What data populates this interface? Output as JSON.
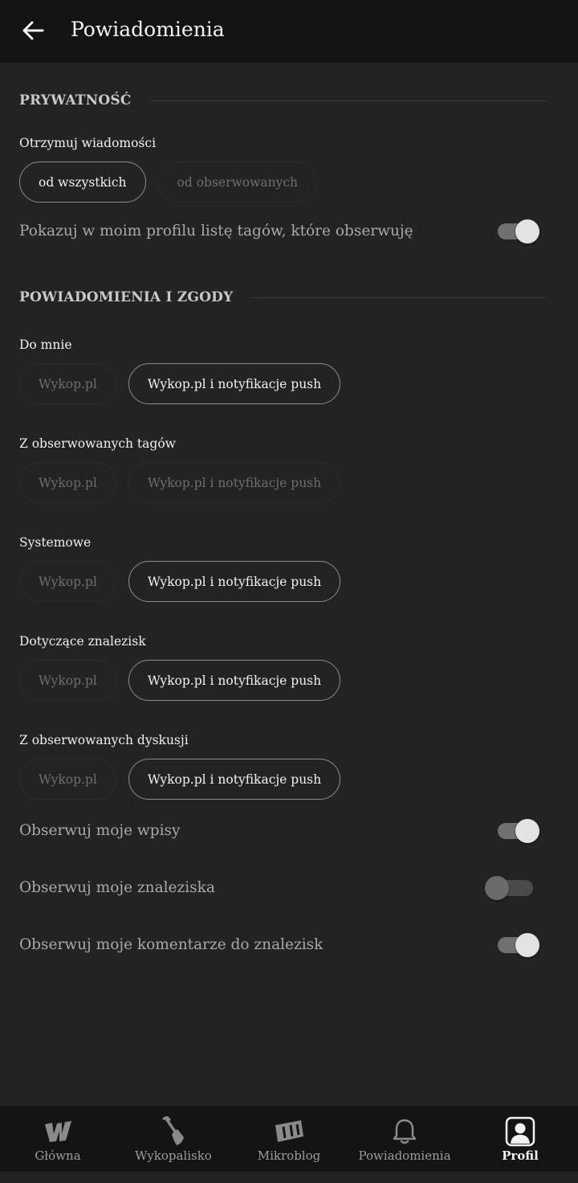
{
  "appbar": {
    "title": "Powiadomienia",
    "back_icon": "arrow-left-icon"
  },
  "privacy": {
    "section_title": "PRYWATNOŚĆ",
    "receive_label": "Otrzymuj wiadomości",
    "receive_options": [
      {
        "label": "od wszystkich",
        "selected": true
      },
      {
        "label": "od obserwowanych",
        "selected": false
      }
    ],
    "show_tags": {
      "label": "Pokazuj w moim profilu listę tagów, które obserwuję",
      "on": true
    }
  },
  "notifications": {
    "section_title": "POWIADOMIENIA I ZGODY",
    "groups": [
      {
        "label": "Do mnie",
        "options": [
          {
            "label": "Wykop.pl",
            "selected": false
          },
          {
            "label": "Wykop.pl i notyfikacje push",
            "selected": true
          }
        ]
      },
      {
        "label": "Z obserwowanych tagów",
        "options": [
          {
            "label": "Wykop.pl",
            "selected": false
          },
          {
            "label": "Wykop.pl i notyfikacje push",
            "selected": false
          }
        ]
      },
      {
        "label": "Systemowe",
        "options": [
          {
            "label": "Wykop.pl",
            "selected": false
          },
          {
            "label": "Wykop.pl i notyfikacje push",
            "selected": true
          }
        ]
      },
      {
        "label": "Dotyczące znalezisk",
        "options": [
          {
            "label": "Wykop.pl",
            "selected": false
          },
          {
            "label": "Wykop.pl i notyfikacje push",
            "selected": true
          }
        ]
      },
      {
        "label": "Z obserwowanych dyskusji",
        "options": [
          {
            "label": "Wykop.pl",
            "selected": false
          },
          {
            "label": "Wykop.pl i notyfikacje push",
            "selected": true
          }
        ]
      }
    ],
    "toggles": [
      {
        "label": "Obserwuj moje wpisy",
        "on": true
      },
      {
        "label": "Obserwuj moje znaleziska",
        "on": false
      },
      {
        "label": "Obserwuj moje komentarze do znalezisk",
        "on": true
      }
    ]
  },
  "bottom_nav": [
    {
      "label": "Główna",
      "icon": "wykop-logo-icon",
      "active": false
    },
    {
      "label": "Wykopalisko",
      "icon": "shovel-icon",
      "active": false
    },
    {
      "label": "Mikroblog",
      "icon": "mikroblog-icon",
      "active": false
    },
    {
      "label": "Powiadomienia",
      "icon": "bell-icon",
      "active": false
    },
    {
      "label": "Profil",
      "icon": "profile-icon",
      "active": true
    }
  ]
}
